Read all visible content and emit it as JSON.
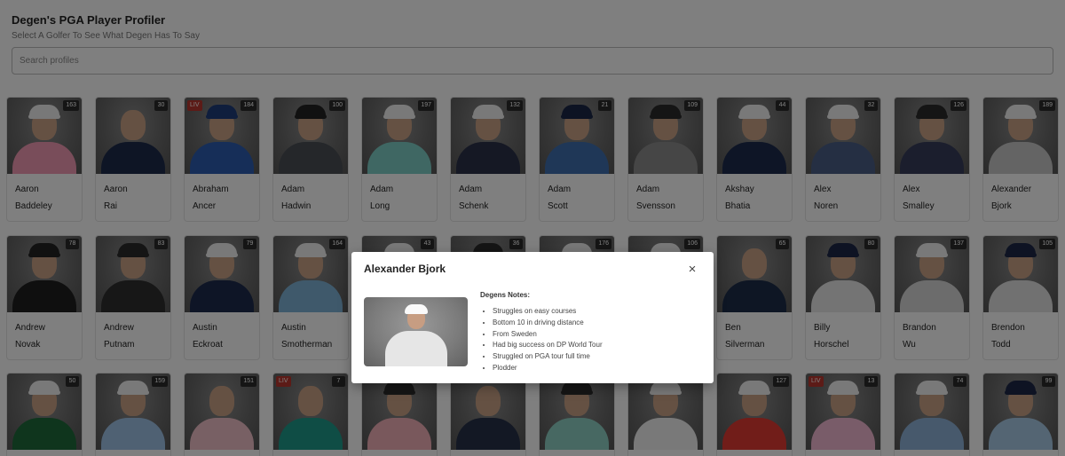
{
  "header": {
    "title": "Degen's PGA Player Profiler",
    "subtitle": "Select A Golfer To See What Degen Has To Say"
  },
  "search": {
    "placeholder": "Search profiles",
    "value": ""
  },
  "colors": {
    "liv_badge": "#b8372f",
    "rank_badge": "#2b2b2b",
    "overlay": "rgba(0,0,0,0.5)"
  },
  "players": [
    {
      "first": "Aaron",
      "last": "Baddeley",
      "rank": "163",
      "liv": false,
      "shirt": "#f29bb4",
      "cap": "#f1f1f1"
    },
    {
      "first": "Aaron",
      "last": "Rai",
      "rank": "30",
      "liv": false,
      "shirt": "#1d2a4a",
      "cap": "none"
    },
    {
      "first": "Abraham",
      "last": "Ancer",
      "rank": "184",
      "liv": true,
      "shirt": "#2c5db0",
      "cap": "#1f3c7a"
    },
    {
      "first": "Adam",
      "last": "Hadwin",
      "rank": "100",
      "liv": false,
      "shirt": "#4a4f55",
      "cap": "#222222"
    },
    {
      "first": "Adam",
      "last": "Long",
      "rank": "197",
      "liv": false,
      "shirt": "#7fcfc6",
      "cap": "#f3f3f3"
    },
    {
      "first": "Adam",
      "last": "Schenk",
      "rank": "132",
      "liv": false,
      "shirt": "#2a3048",
      "cap": "#f3f3f3"
    },
    {
      "first": "Adam",
      "last": "Scott",
      "rank": "21",
      "liv": false,
      "shirt": "#3f6fae",
      "cap": "#1b2746"
    },
    {
      "first": "Adam",
      "last": "Svensson",
      "rank": "109",
      "liv": false,
      "shirt": "#8c8c8c",
      "cap": "#2b2b2b"
    },
    {
      "first": "Akshay",
      "last": "Bhatia",
      "rank": "44",
      "liv": false,
      "shirt": "#1c2a4d",
      "cap": "#f3f3f3"
    },
    {
      "first": "Alex",
      "last": "Noren",
      "rank": "32",
      "liv": false,
      "shirt": "#4b5f86",
      "cap": "#f3f3f3"
    },
    {
      "first": "Alex",
      "last": "Smalley",
      "rank": "126",
      "liv": false,
      "shirt": "#363c5a",
      "cap": "#2b2b2b"
    },
    {
      "first": "Alexander",
      "last": "Bjork",
      "rank": "189",
      "liv": false,
      "shirt": "#c8c8c8",
      "cap": "#f3f3f3"
    },
    {
      "first": "Andrew",
      "last": "Novak",
      "rank": "78",
      "liv": false,
      "shirt": "#1e1e1e",
      "cap": "#222222"
    },
    {
      "first": "Andrew",
      "last": "Putnam",
      "rank": "83",
      "liv": false,
      "shirt": "#2f2f2f",
      "cap": "#2b2b2b"
    },
    {
      "first": "Austin",
      "last": "Eckroat",
      "rank": "79",
      "liv": false,
      "shirt": "#1d2b4c",
      "cap": "#f3f3f3"
    },
    {
      "first": "Austin",
      "last": "Smotherman",
      "rank": "164",
      "liv": false,
      "shirt": "#7fb3d6",
      "cap": "#f3f3f3"
    },
    {
      "first": "",
      "last": "",
      "rank": "43",
      "liv": false,
      "shirt": "#9a9a9a",
      "cap": "#f3f3f3"
    },
    {
      "first": "",
      "last": "",
      "rank": "36",
      "liv": false,
      "shirt": "#9a9a9a",
      "cap": "#2b2b2b"
    },
    {
      "first": "",
      "last": "",
      "rank": "176",
      "liv": false,
      "shirt": "#9a9a9a",
      "cap": "#f3f3f3"
    },
    {
      "first": "",
      "last": "",
      "rank": "106",
      "liv": false,
      "shirt": "#9a9a9a",
      "cap": "#f3f3f3"
    },
    {
      "first": "Ben",
      "last": "Silverman",
      "rank": "65",
      "liv": false,
      "shirt": "#1c2c49",
      "cap": "none"
    },
    {
      "first": "Billy",
      "last": "Horschel",
      "rank": "80",
      "liv": false,
      "shirt": "#e9e9e9",
      "cap": "#1c2746"
    },
    {
      "first": "Brandon",
      "last": "Wu",
      "rank": "137",
      "liv": false,
      "shirt": "#d9d9d9",
      "cap": "#f3f3f3"
    },
    {
      "first": "Brendon",
      "last": "Todd",
      "rank": "105",
      "liv": false,
      "shirt": "#e3e3e3",
      "cap": "#1c2746"
    },
    {
      "first": "",
      "last": "",
      "rank": "50",
      "liv": false,
      "shirt": "#1f6a3a",
      "cap": "#f3f3f3"
    },
    {
      "first": "",
      "last": "",
      "rank": "159",
      "liv": false,
      "shirt": "#9ec2e6",
      "cap": "#f3f3f3"
    },
    {
      "first": "",
      "last": "",
      "rank": "151",
      "liv": false,
      "shirt": "#f0c0c8",
      "cap": "none"
    },
    {
      "first": "",
      "last": "",
      "rank": "7",
      "liv": true,
      "shirt": "#1f9a8a",
      "cap": "none"
    },
    {
      "first": "",
      "last": "",
      "rank": "",
      "liv": false,
      "shirt": "#f3b0b8",
      "cap": "#2b2b2b"
    },
    {
      "first": "",
      "last": "",
      "rank": "",
      "liv": false,
      "shirt": "#263048",
      "cap": "none"
    },
    {
      "first": "",
      "last": "",
      "rank": "",
      "liv": false,
      "shirt": "#8fd0c4",
      "cap": "#2b2b2b"
    },
    {
      "first": "",
      "last": "",
      "rank": "",
      "liv": false,
      "shirt": "#f3f3f3",
      "cap": "#f3f3f3"
    },
    {
      "first": "",
      "last": "",
      "rank": "127",
      "liv": false,
      "shirt": "#e23a32",
      "cap": "#f3f3f3"
    },
    {
      "first": "",
      "last": "",
      "rank": "13",
      "liv": true,
      "shirt": "#f2b8d2",
      "cap": "#f3f3f3"
    },
    {
      "first": "",
      "last": "",
      "rank": "74",
      "liv": false,
      "shirt": "#8fb3d9",
      "cap": "#f3f3f3"
    },
    {
      "first": "",
      "last": "",
      "rank": "99",
      "liv": false,
      "shirt": "#a9cbe6",
      "cap": "#1c2746"
    }
  ],
  "modal": {
    "title": "Alexander Bjork",
    "close_label": "×",
    "notes_title": "Degens Notes:",
    "notes": [
      "Struggles on easy courses",
      "Bottom 10 in driving distance",
      "From Sweden",
      "Had big success on DP World Tour",
      "Struggled on PGA tour full time",
      "Plodder"
    ]
  }
}
